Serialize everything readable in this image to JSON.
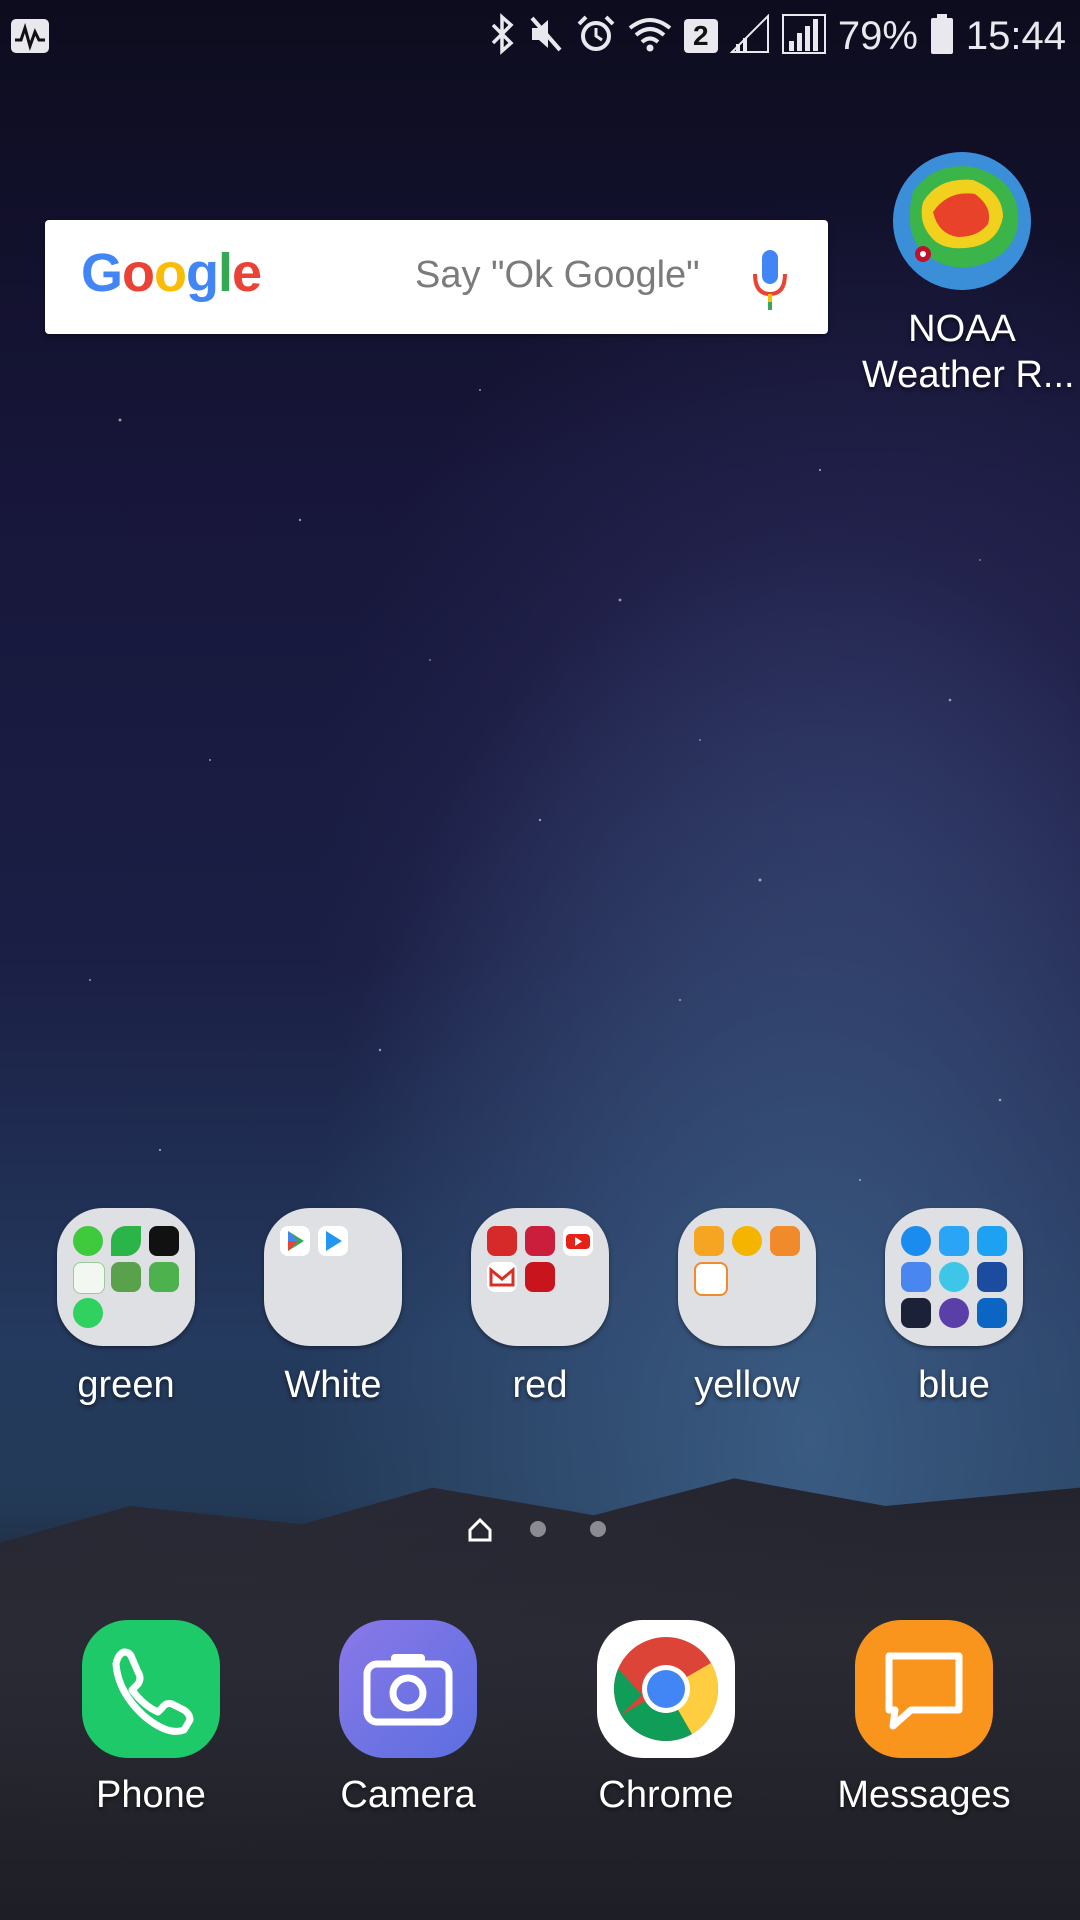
{
  "status_bar": {
    "notification_icon": "activity-graph-icon",
    "icons": [
      "bluetooth-icon",
      "mute-icon",
      "alarm-icon",
      "wifi-icon",
      "sim-badge-icon",
      "signal-icon",
      "signal-icon"
    ],
    "sim_badge": "2",
    "battery": "79%",
    "time": "15:44"
  },
  "search_widget": {
    "logo": "Google",
    "hint": "Say \"Ok Google\"",
    "mic_icon": "microphone-icon"
  },
  "widgets": {
    "noaa": {
      "label_line1": "NOAA",
      "label_line2": "Weather R..."
    }
  },
  "folders": [
    {
      "label": "green"
    },
    {
      "label": "White"
    },
    {
      "label": "red"
    },
    {
      "label": "yellow"
    },
    {
      "label": "blue"
    }
  ],
  "pager": {
    "home_icon": "home-page-icon",
    "pages": 3,
    "current": 1
  },
  "dock": [
    {
      "label": "Phone",
      "icon": "phone-icon",
      "color": "#1ec96a"
    },
    {
      "label": "Camera",
      "icon": "camera-icon",
      "color": "#6f6fe0"
    },
    {
      "label": "Chrome",
      "icon": "chrome-icon",
      "color": "#ffffff"
    },
    {
      "label": "Messages",
      "icon": "messages-icon",
      "color": "#f9941c"
    }
  ],
  "colors": {
    "google_blue": "#4285F4",
    "google_red": "#EA4335",
    "google_yellow": "#FBBC05",
    "google_green": "#34A853",
    "folder_bg": "#dfe0e4"
  }
}
